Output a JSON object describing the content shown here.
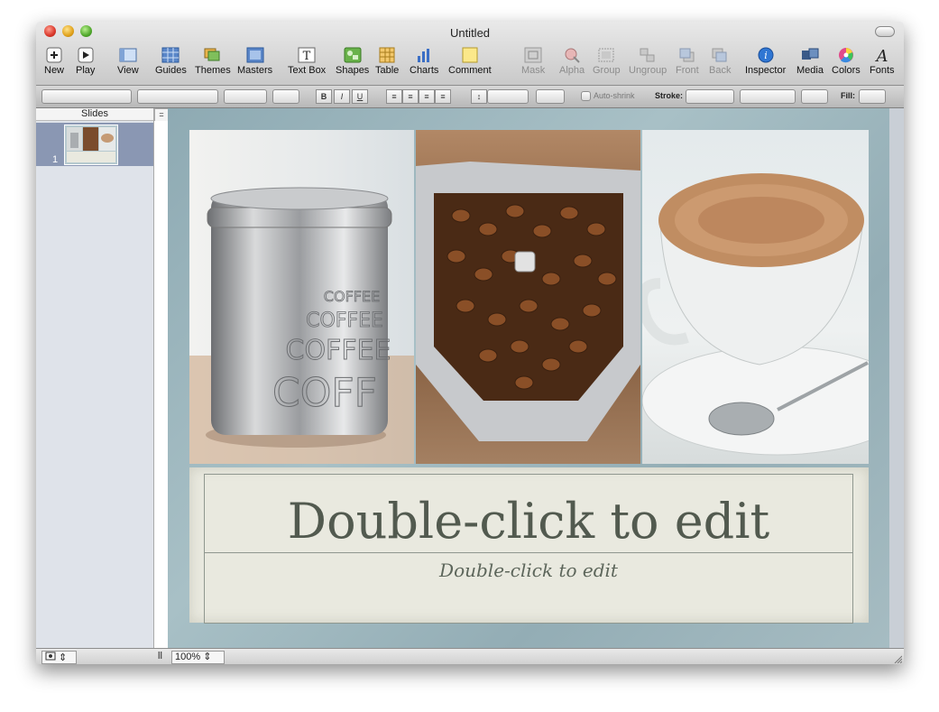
{
  "window": {
    "title": "Untitled"
  },
  "toolbar": {
    "new": "New",
    "play": "Play",
    "view": "View",
    "guides": "Guides",
    "themes": "Themes",
    "masters": "Masters",
    "text_box": "Text Box",
    "shapes": "Shapes",
    "table": "Table",
    "charts": "Charts",
    "comment": "Comment",
    "mask": "Mask",
    "alpha": "Alpha",
    "group": "Group",
    "ungroup": "Ungroup",
    "front": "Front",
    "back": "Back",
    "inspector": "Inspector",
    "media": "Media",
    "colors": "Colors",
    "fonts": "Fonts"
  },
  "format_bar": {
    "bold": "B",
    "italic": "I",
    "underline": "U",
    "auto_shrink": "Auto-shrink",
    "stroke_label": "Stroke:",
    "fill_label": "Fill:"
  },
  "sidebar": {
    "header": "Slides",
    "slides": [
      {
        "number": "1"
      }
    ]
  },
  "slide": {
    "title_placeholder": "Double-click to edit",
    "subtitle_placeholder": "Double-click to edit",
    "photo_text": [
      "COFFEE",
      "COFFEE",
      "COFFEE",
      "COFF"
    ]
  },
  "status": {
    "zoom": "100%"
  },
  "colors": {
    "accent_blue": "#2f76d3",
    "slide_frame": "#9eb6bd",
    "text_panel": "#e9e9df"
  }
}
